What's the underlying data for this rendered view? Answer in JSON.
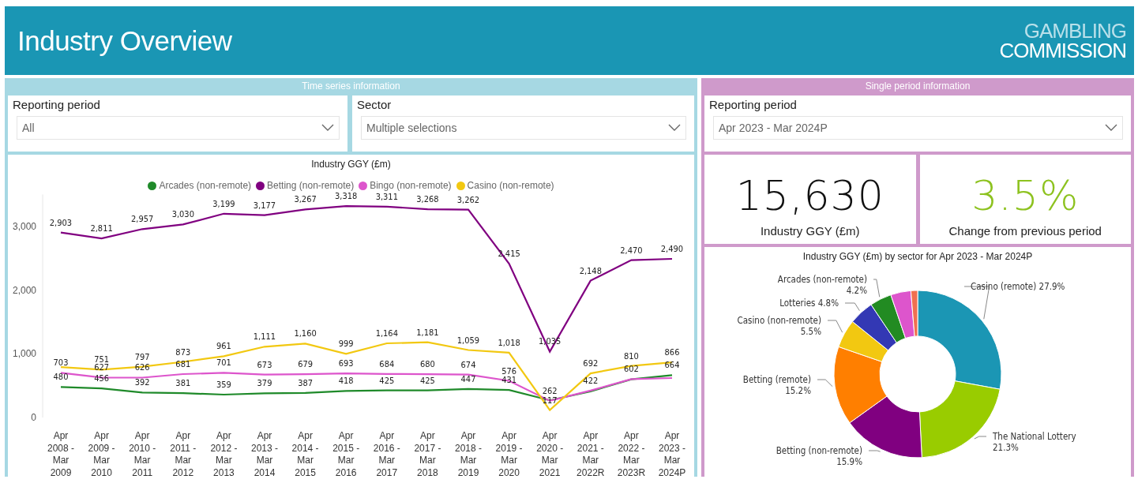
{
  "header": {
    "title": "Industry Overview",
    "logo": [
      "GAMBLING",
      "COMMISSION"
    ]
  },
  "time_series": {
    "heading": "Time series information",
    "slicers": [
      {
        "label": "Reporting period",
        "value": "All"
      },
      {
        "label": "Sector",
        "value": "Multiple selections"
      }
    ],
    "chart": {
      "chart_data": {
        "type": "line",
        "title": "Industry GGY (£m)",
        "data_labels": true,
        "categories": [
          "Apr 2008 - Mar 2009",
          "Apr 2009 - Mar 2010",
          "Apr 2010 - Mar 2011",
          "Apr 2011 - Mar 2012",
          "Apr 2012 - Mar 2013",
          "Apr 2013 - Mar 2014",
          "Apr 2014 - Mar 2015",
          "Apr 2015 - Mar 2016",
          "Apr 2016 - Mar 2017",
          "Apr 2017 - Mar 2018",
          "Apr 2018 - Mar 2019",
          "Apr 2019 - Mar 2020",
          "Apr 2020 - Mar 2021",
          "Apr 2021 - Mar 2022R",
          "Apr 2022 - Mar 2023R",
          "Apr 2023 - Mar 2024P"
        ],
        "ylim": [
          0,
          3500
        ],
        "yticks": [
          {
            "value": 0,
            "label": "0"
          },
          {
            "value": 1000,
            "label": "1,000"
          },
          {
            "value": 2000,
            "label": "2,000"
          },
          {
            "value": 3000,
            "label": "3,000"
          }
        ],
        "series": [
          {
            "name": "Arcades (non-remote)",
            "color": "#1f8a2a",
            "values": [
              480,
              456,
              392,
              381,
              359,
              379,
              387,
              418,
              425,
              425,
              447,
              431,
              270,
              410,
              600,
              664
            ],
            "value_labels": [
              "480",
              "456",
              "392",
              "381",
              "359",
              "379",
              "387",
              "418",
              "425",
              "425",
              "447",
              "431",
              null,
              null,
              null,
              "664"
            ]
          },
          {
            "name": "Betting (non-remote)",
            "color": "#800080",
            "values": [
              2903,
              2811,
              2957,
              3030,
              3199,
              3177,
              3267,
              3318,
              3311,
              3268,
              3262,
              2415,
              1035,
              2148,
              2470,
              2490
            ],
            "value_labels": [
              "2,903",
              "2,811",
              "2,957",
              "3,030",
              "3,199",
              "3,177",
              "3,267",
              "3,318",
              "3,311",
              "3,268",
              "3,262",
              "2,415",
              "1,035",
              "2,148",
              "2,470",
              "2,490"
            ]
          },
          {
            "name": "Bingo (non-remote)",
            "color": "#dd55cc",
            "values": [
              703,
              627,
              626,
              681,
              701,
              673,
              679,
              693,
              684,
              680,
              674,
              576,
              262,
              422,
              602,
              620
            ],
            "value_labels": [
              "703",
              "627",
              "626",
              "681",
              "701",
              "673",
              "679",
              "693",
              "684",
              "680",
              "674",
              "576",
              "262",
              "422",
              "602",
              null
            ]
          },
          {
            "name": "Casino (non-remote)",
            "color": "#f2c811",
            "values": [
              790,
              751,
              797,
              873,
              961,
              1111,
              1160,
              999,
              1164,
              1181,
              1059,
              1018,
              117,
              692,
              810,
              866
            ],
            "value_labels": [
              null,
              "751",
              "797",
              "873",
              "961",
              "1,111",
              "1,160",
              "999",
              "1,164",
              "1,181",
              "1,059",
              "1,018",
              "117",
              "692",
              "810",
              "866"
            ]
          }
        ]
      }
    }
  },
  "single_period": {
    "heading": "Single period information",
    "slicer": {
      "label": "Reporting period",
      "value": "Apr 2023 - Mar 2024P"
    },
    "kpis": [
      {
        "kind": "total",
        "value": "15,630",
        "label": "Industry GGY (£m)"
      },
      {
        "kind": "change",
        "value": "3.5%",
        "label": "Change from previous period"
      }
    ],
    "donut": {
      "chart_data": {
        "type": "donut",
        "title": "Industry GGY (£m) by sector for Apr 2023 - Mar 2024P",
        "categories": [
          "Casino (remote)",
          "The National Lottery",
          "Betting (non-remote)",
          "Betting (remote)",
          "Casino (non-remote)",
          "Lotteries",
          "Arcades (non-remote)",
          null,
          null
        ],
        "values": [
          27.9,
          21.3,
          15.9,
          15.2,
          5.5,
          4.8,
          4.2,
          3.9,
          1.3
        ],
        "value_labels": [
          "27.9%",
          "21.3%",
          "15.9%",
          "15.2%",
          "5.5%",
          "4.8%",
          "4.2%",
          null,
          null
        ],
        "colors": [
          "#1b96b4",
          "#99cc00",
          "#800080",
          "#ff7f00",
          "#f2c811",
          "#3338b4",
          "#228b22",
          "#dd55cc",
          "#f07050"
        ]
      }
    }
  }
}
